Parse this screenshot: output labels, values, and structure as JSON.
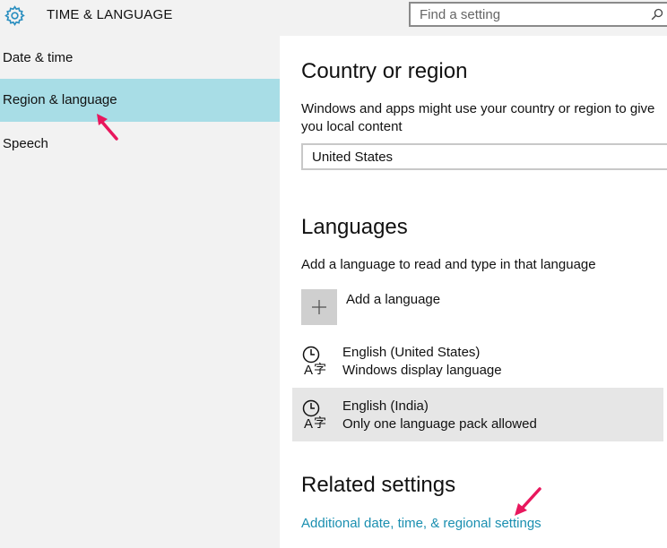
{
  "header": {
    "title": "TIME & LANGUAGE",
    "search_placeholder": "Find a setting",
    "icons": {
      "app": "gear-icon",
      "search": "search-icon"
    }
  },
  "sidebar": {
    "items": [
      {
        "label": "Date & time",
        "selected": false
      },
      {
        "label": "Region & language",
        "selected": true
      },
      {
        "label": "Speech",
        "selected": false
      }
    ],
    "selected_color": "#a8dde6"
  },
  "main": {
    "country": {
      "heading": "Country or region",
      "description": "Windows and apps might use your country or region to give you local content",
      "selected_value": "United States"
    },
    "languages": {
      "heading": "Languages",
      "description": "Add a language to read and type in that language",
      "add_label": "Add a language",
      "items": [
        {
          "name": "English (United States)",
          "detail": "Windows display language",
          "icon": "language-icon",
          "selected": false
        },
        {
          "name": "English (India)",
          "detail": "Only one language pack allowed",
          "icon": "language-icon",
          "selected": true
        }
      ]
    },
    "related": {
      "heading": "Related settings",
      "link": "Additional date, time, & regional settings",
      "link_color": "#1a8fb0"
    }
  },
  "annotations": {
    "arrow_color": "#e8175d"
  }
}
